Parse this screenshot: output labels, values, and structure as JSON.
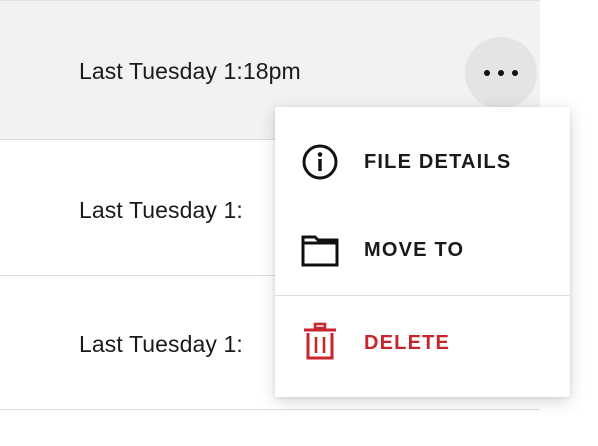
{
  "rows": [
    {
      "date": "Last Tuesday 1:18pm"
    },
    {
      "date": "Last Tuesday 1:"
    },
    {
      "date": "Last Tuesday 1:"
    }
  ],
  "row_actions": {
    "icon": "more-horizontal-icon"
  },
  "context_menu": {
    "items": [
      {
        "label": "FILE DETAILS",
        "icon": "info-icon"
      },
      {
        "label": "MOVE TO",
        "icon": "folder-icon"
      },
      {
        "label": "DELETE",
        "icon": "trash-icon",
        "color": "#c8262d"
      }
    ]
  },
  "colors": {
    "selected_row_bg": "#f2f2f2",
    "more_button_bg": "#e4e4e4",
    "danger": "#c8262d",
    "text": "#1a1a1a"
  }
}
